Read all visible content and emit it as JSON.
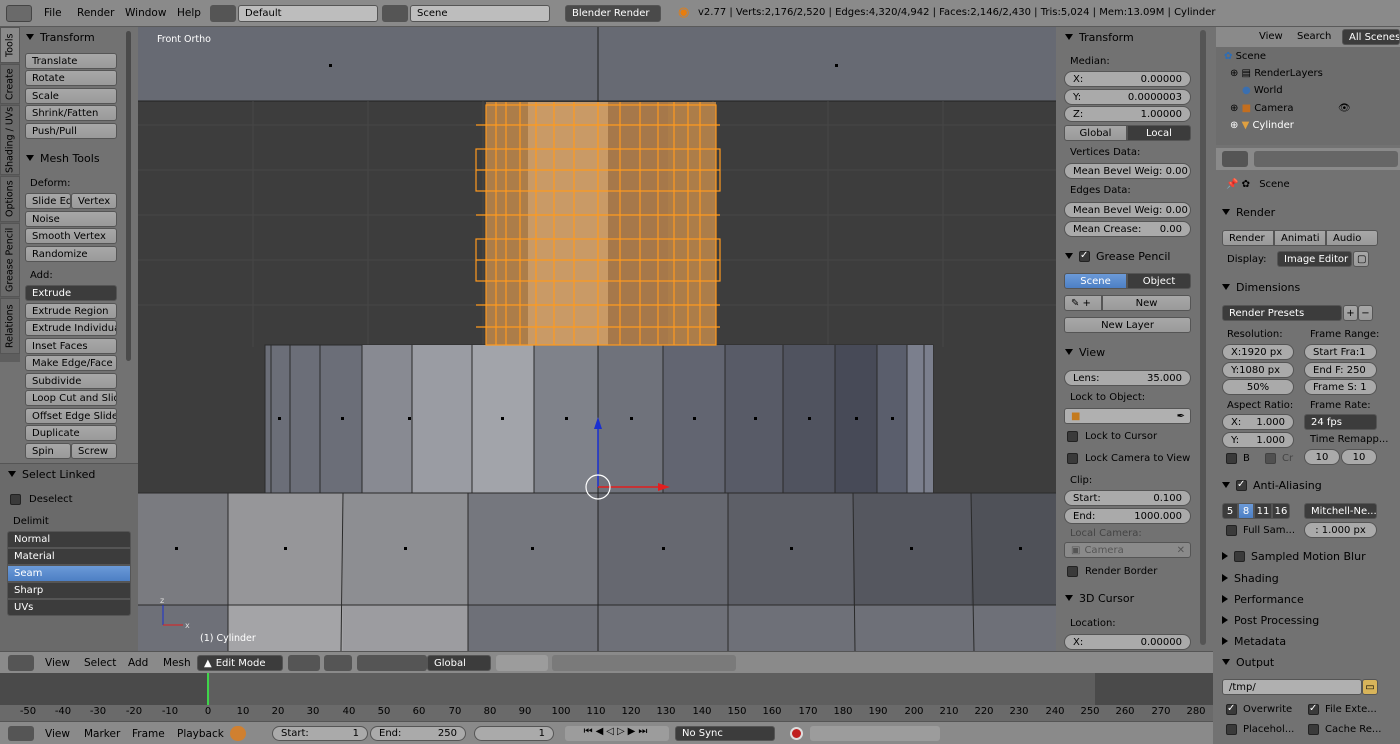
{
  "topbar": {
    "menus": [
      "File",
      "Render",
      "Window",
      "Help"
    ],
    "layout": "Default",
    "scene": "Scene",
    "engine": "Blender Render",
    "stats": "v2.77 | Verts:2,176/2,520 | Edges:4,320/4,942 | Faces:2,146/2,430 | Tris:5,024 | Mem:13.09M | Cylinder"
  },
  "left_tabs": [
    "Tools",
    "Create",
    "Shading / UVs",
    "Options",
    "Grease Pencil",
    "Relations"
  ],
  "tools": {
    "transform_title": "Transform",
    "transform": [
      "Translate",
      "Rotate",
      "Scale",
      "Shrink/Fatten",
      "Push/Pull"
    ],
    "mesh_title": "Mesh Tools",
    "deform_label": "Deform:",
    "slide_edge": "Slide Ed",
    "vertex": "Vertex",
    "noise": "Noise",
    "smooth": "Smooth Vertex",
    "randomize": "Randomize",
    "add_label": "Add:",
    "extrude": "Extrude",
    "add_items": [
      "Extrude Region",
      "Extrude Individual",
      "Inset Faces",
      "Make Edge/Face",
      "Subdivide",
      "Loop Cut and Slide",
      "Offset Edge Slide",
      "Duplicate"
    ],
    "spin": "Spin",
    "screw": "Screw"
  },
  "operator": {
    "title": "Select Linked",
    "deselect": "Deselect",
    "delimit_label": "Delimit",
    "delimit": [
      "Normal",
      "Material",
      "Seam",
      "Sharp",
      "UVs"
    ]
  },
  "viewport": {
    "view_label": "Front Ortho",
    "object_label": "(1) Cylinder"
  },
  "npanel": {
    "transform_title": "Transform",
    "median": "Median:",
    "x_label": "X:",
    "x": "0.00000",
    "y_label": "Y:",
    "y": "0.0000003",
    "z_label": "Z:",
    "z": "1.00000",
    "global": "Global",
    "local": "Local",
    "vertices_data": "Vertices Data:",
    "mean_bevel_v": "Mean Bevel Weig: 0.00",
    "edges_data": "Edges Data:",
    "mean_bevel_e": "Mean Bevel Weig: 0.00",
    "crease_label": "Mean Crease:",
    "crease": "0.00",
    "grease_title": "Grease Pencil",
    "gp_scene": "Scene",
    "gp_object": "Object",
    "gp_new": "New",
    "gp_new_layer": "New Layer",
    "view_title": "View",
    "lens_label": "Lens:",
    "lens": "35.000",
    "lock_object": "Lock to Object:",
    "lock_cursor": "Lock to Cursor",
    "lock_camera": "Lock Camera to View",
    "clip": "Clip:",
    "start_label": "Start:",
    "start": "0.100",
    "end_label": "End:",
    "end": "1000.000",
    "local_camera": "Local Camera:",
    "camera": "Camera",
    "render_border": "Render Border",
    "cursor_title": "3D Cursor",
    "location": "Location:",
    "cx_label": "X:",
    "cx": "0.00000"
  },
  "outliner": {
    "tabs": [
      "View",
      "Search",
      "All Scenes"
    ],
    "items": [
      "Scene",
      "RenderLayers",
      "World",
      "Camera",
      "Cylinder"
    ]
  },
  "properties": {
    "scene": "Scene",
    "render_title": "Render",
    "render_btns": [
      "Render",
      "Animati",
      "Audio"
    ],
    "display_label": "Display:",
    "display": "Image Editor",
    "dimensions_title": "Dimensions",
    "render_presets": "Render Presets",
    "resolution": "Resolution:",
    "res_x": "X:1920 px",
    "res_y": "Y:1080 px",
    "res_pct": "50%",
    "frame_range": "Frame Range:",
    "start_frame": "Start Fra:1",
    "end_frame": "End F: 250",
    "frame_step": "Frame S: 1",
    "aspect": "Aspect Ratio:",
    "asp_x_label": "X:",
    "asp_x": "1.000",
    "asp_y_label": "Y:",
    "asp_y": "1.000",
    "frame_rate": "Frame Rate:",
    "fps": "24 fps",
    "time_remap": "Time Remapp...",
    "remap_a": "10",
    "remap_b": "10",
    "b_label": "B",
    "cr_label": "Cr",
    "aa_title": "Anti-Aliasing",
    "aa_samples": [
      "5",
      "8",
      "11",
      "16"
    ],
    "aa_filter": "Mitchell-Ne...",
    "full_sample": "Full Sam...",
    "filter_size": ": 1.000 px",
    "motion_blur": "Sampled Motion Blur",
    "shading": "Shading",
    "performance": "Performance",
    "post": "Post Processing",
    "metadata": "Metadata",
    "output": "Output",
    "path": "/tmp/",
    "overwrite": "Overwrite",
    "file_ext": "File Exte...",
    "placeholder": "Placehol...",
    "cache": "Cache Re..."
  },
  "view3d_header": {
    "menus": [
      "View",
      "Select",
      "Add",
      "Mesh"
    ],
    "mode": "Edit Mode",
    "orientation": "Global"
  },
  "timeline": {
    "ticks": [
      "-50",
      "-40",
      "-30",
      "-20",
      "-10",
      "0",
      "10",
      "20",
      "30",
      "40",
      "50",
      "60",
      "70",
      "80",
      "90",
      "100",
      "110",
      "120",
      "130",
      "140",
      "150",
      "160",
      "170",
      "180",
      "190",
      "200",
      "210",
      "220",
      "230",
      "240",
      "250",
      "260",
      "270",
      "280"
    ],
    "menus": [
      "View",
      "Marker",
      "Frame",
      "Playback"
    ],
    "start_label": "Start:",
    "start": "1",
    "end_label": "End:",
    "end": "250",
    "current": "1",
    "sync": "No Sync"
  },
  "colors": {
    "selected": "#f5a623",
    "accent": "#5680c2",
    "viewport_bg": "#3d3d3d"
  }
}
